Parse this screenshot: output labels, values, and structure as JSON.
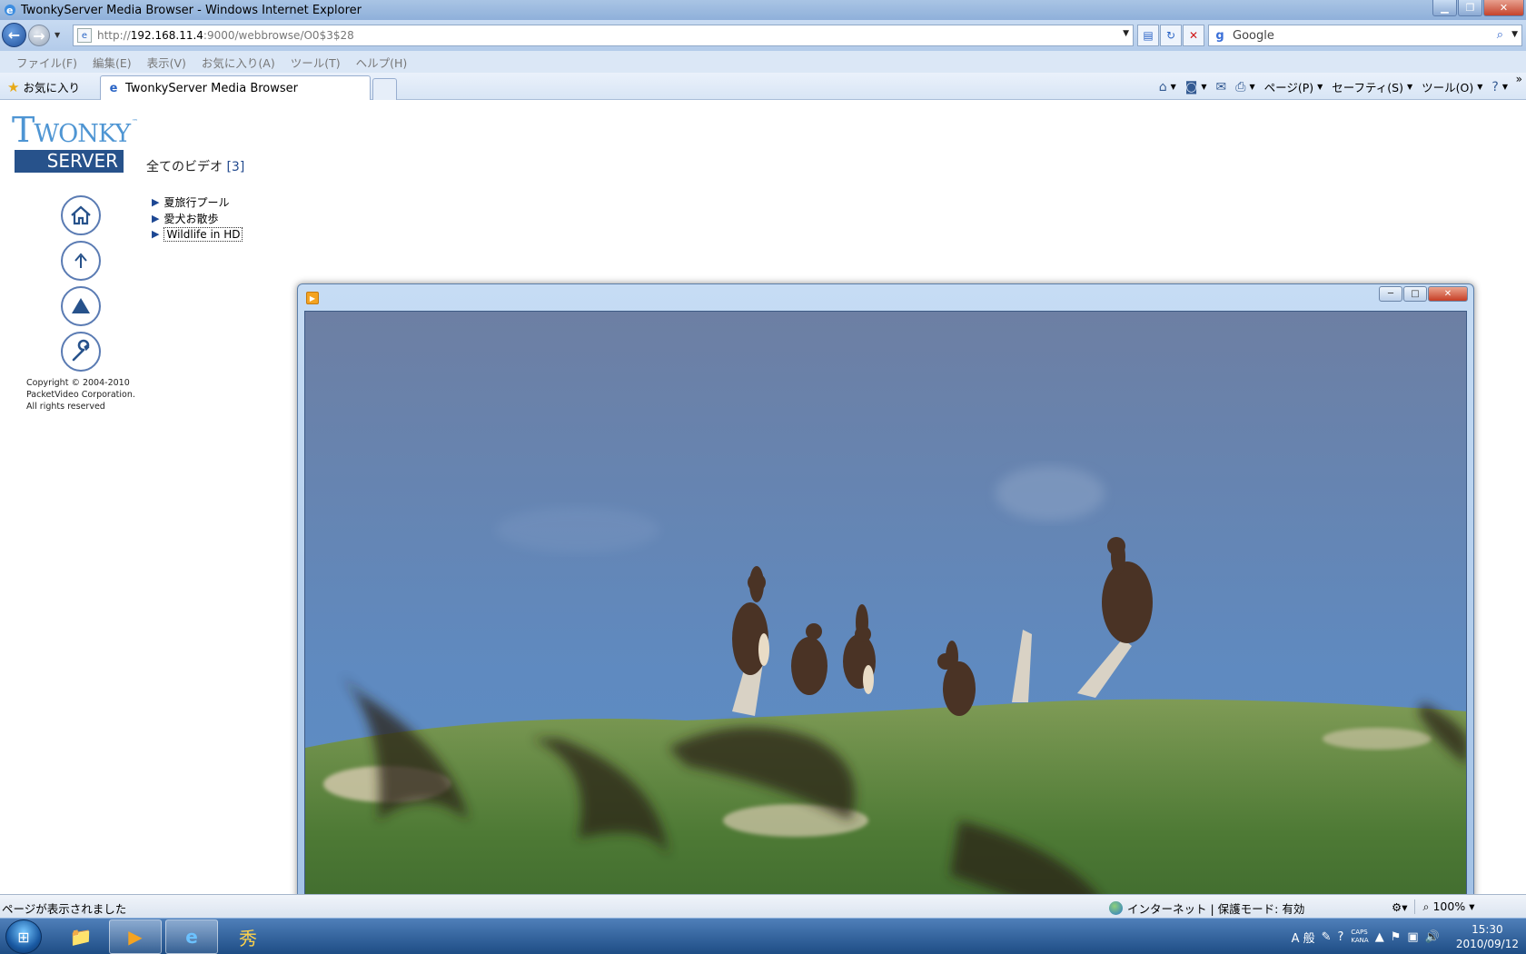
{
  "window": {
    "title": "TwonkyServer Media Browser - Windows Internet Explorer",
    "buttons": {
      "minimize": "▁",
      "maximize": "❐",
      "close": "✕"
    }
  },
  "address_bar": {
    "url_prefix": "http://",
    "url_host": "192.168.11.4",
    "url_rest": ":9000/webbrowse/O0$3$28"
  },
  "search": {
    "placeholder": "Google",
    "provider_icon": "google-icon"
  },
  "menu": [
    "ファイル(F)",
    "編集(E)",
    "表示(V)",
    "お気に入り(A)",
    "ツール(T)",
    "ヘルプ(H)"
  ],
  "favorites": {
    "label": "お気に入り"
  },
  "tab": {
    "title": "TwonkyServer Media Browser"
  },
  "command_bar": {
    "page": "ページ(P)",
    "safety": "セーフティ(S)",
    "tools": "ツール(O)",
    "help_icon": "?"
  },
  "page": {
    "logo": {
      "top": "Twonky",
      "bottom": "SERVER",
      "tm": "™"
    },
    "breadcrumb": {
      "label": "全てのビデオ",
      "count": "[3]"
    },
    "nav_icons": [
      "home-icon",
      "up-icon",
      "top-icon",
      "settings-icon"
    ],
    "copyright": [
      "Copyright © 2004-2010",
      "PacketVideo Corporation.",
      "All rights reserved"
    ],
    "folders": [
      {
        "label": "夏旅行プール"
      },
      {
        "label": "愛犬お散歩"
      },
      {
        "label": "Wildlife in HD"
      }
    ]
  },
  "video_window": {
    "buttons": {
      "minimize": "─",
      "maximize": "□",
      "close": "✕"
    }
  },
  "status_bar": {
    "text": "ページが表示されました",
    "zone": "インターネット | 保護モード: 有効",
    "zoom": "100%"
  },
  "taskbar": {
    "clock_time": "15:30",
    "clock_date": "2010/09/12",
    "ime": "A 般",
    "caps": "CAPS",
    "kana": "KANA"
  }
}
